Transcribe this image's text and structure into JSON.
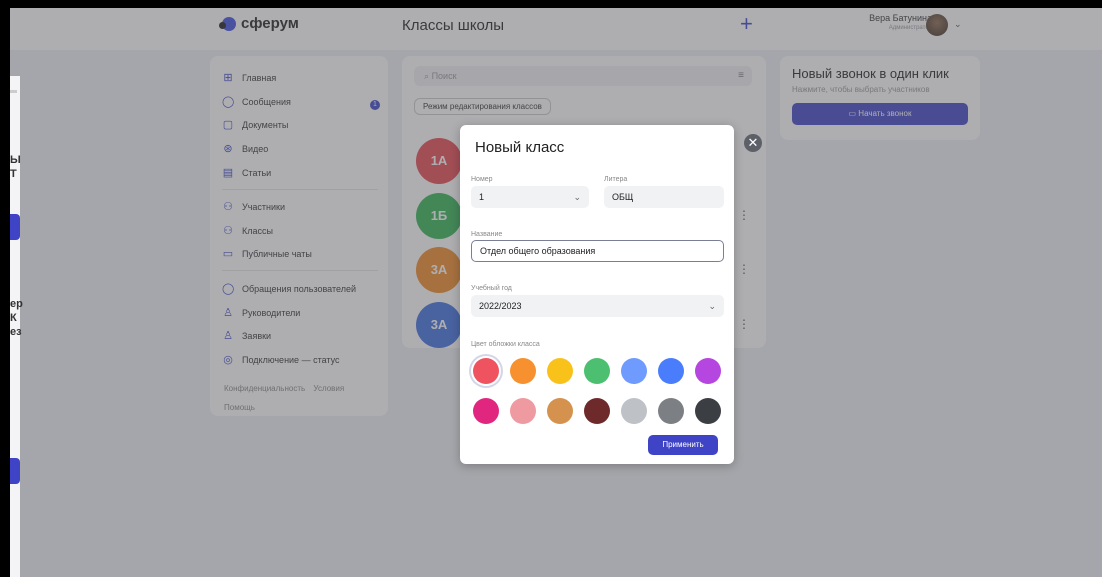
{
  "left_strip": {
    "fragments": [
      "Ы",
      "Т",
      "ер",
      "К",
      "ез"
    ]
  },
  "topbar": {
    "logo": "сферум",
    "page_title": "Классы школы",
    "add_icon": "plus-icon",
    "user_name": "Вера Батунина",
    "user_role": "Администратор"
  },
  "sidebar": {
    "items": [
      {
        "label": "Главная",
        "icon": "home-icon"
      },
      {
        "label": "Сообщения",
        "icon": "message-icon"
      },
      {
        "label": "Документы",
        "icon": "document-icon"
      },
      {
        "label": "Видео",
        "icon": "video-icon"
      },
      {
        "label": "Статьи",
        "icon": "article-icon"
      },
      {
        "label": "Участники",
        "icon": "members-icon"
      },
      {
        "label": "Классы",
        "icon": "classes-icon"
      },
      {
        "label": "Публичные чаты",
        "icon": "chats-icon"
      },
      {
        "label": "Обращения пользователей",
        "icon": "feedback-icon"
      },
      {
        "label": "Руководители",
        "icon": "person-icon"
      },
      {
        "label": "Заявки",
        "icon": "add-person-icon"
      },
      {
        "label": "Подключение — статус",
        "icon": "status-icon"
      }
    ],
    "messages_badge": "1",
    "footer_links": [
      "Конфиденциальность",
      "Условия"
    ],
    "help": "Помощь"
  },
  "classes": {
    "search_placeholder": "Поиск",
    "manage_button": "Режим редактирования классов",
    "items": [
      {
        "name": "1А",
        "color": "#e9474f"
      },
      {
        "name": "1Б",
        "color": "#33b454"
      },
      {
        "name": "3А",
        "color": "#f08a25"
      },
      {
        "name": "3А",
        "color": "#3e6fe0"
      }
    ]
  },
  "call": {
    "title": "Новый звонок в один клик",
    "subtitle": "Нажмите, чтобы выбрать участников",
    "button": "Начать звонок"
  },
  "modal": {
    "title": "Новый класс",
    "number_label": "Номер",
    "number_value": "1",
    "letter_label": "Литера",
    "letter_value": "ОБЩ",
    "name_label": "Название",
    "name_value": "Отдел общего образования",
    "year_label": "Учебный год",
    "year_value": "2022/2023",
    "color_label": "Цвет обложки класса",
    "colors": [
      "#ef5360",
      "#f7912f",
      "#f9c21b",
      "#4dbf71",
      "#6f9bff",
      "#4a7dfb",
      "#b646e0",
      "#e0267f",
      "#ef9aa0",
      "#d4924e",
      "#6e2a2a",
      "#bec2c7",
      "#7c8085",
      "#3b3e42"
    ],
    "selected_color": 0,
    "apply_button": "Применить"
  }
}
